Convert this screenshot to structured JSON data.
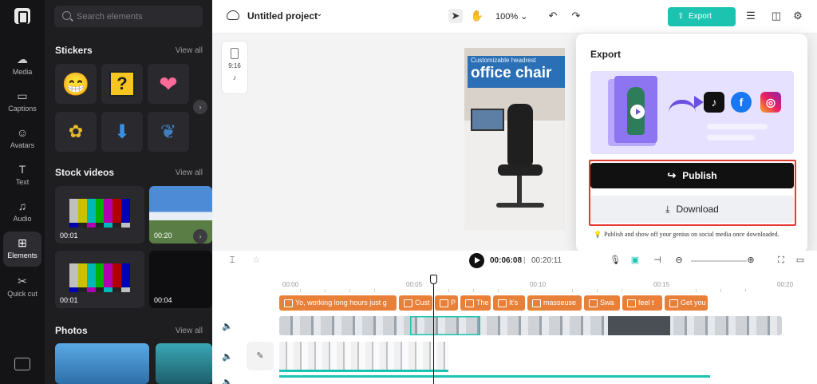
{
  "sidebar": {
    "items": [
      {
        "label": "Media",
        "icon": "media-icon"
      },
      {
        "label": "Captions",
        "icon": "captions-icon"
      },
      {
        "label": "Avatars",
        "icon": "avatars-icon"
      },
      {
        "label": "Text",
        "icon": "text-icon"
      },
      {
        "label": "Audio",
        "icon": "audio-icon"
      },
      {
        "label": "Elements",
        "icon": "elements-icon",
        "active": true
      },
      {
        "label": "Quick cut",
        "icon": "quick-cut-icon"
      }
    ]
  },
  "panel": {
    "search_placeholder": "Search elements",
    "sections": {
      "stickers": {
        "title": "Stickers",
        "view_all": "View all"
      },
      "stock_videos": {
        "title": "Stock videos",
        "view_all": "View all"
      },
      "photos": {
        "title": "Photos",
        "view_all": "View all"
      }
    },
    "videos": [
      {
        "duration": "00:01"
      },
      {
        "duration": "00:20"
      },
      {
        "duration": "00:01"
      },
      {
        "duration": "00:04"
      }
    ]
  },
  "topbar": {
    "project_title": "Untitled project",
    "zoom": "100%",
    "export_label": "Export"
  },
  "canvas": {
    "ratio_label": "9:16",
    "preview_small": "Customizable headrest",
    "preview_big": "office chair"
  },
  "export_popup": {
    "title": "Export",
    "publish_label": "Publish",
    "download_label": "Download",
    "tip": "Publish and show off your genius on social media once downloaded."
  },
  "timeline": {
    "current_time": "00:06:08",
    "separator": "|",
    "total_time": "00:20:11",
    "ruler": [
      "00:00",
      "00:05",
      "00:10",
      "00:15",
      "00:20"
    ],
    "captions": [
      "Yo, working long hours just g",
      "Cust",
      "P",
      "The",
      "It's",
      "masseuse",
      "Swa",
      "feel t",
      "Get you"
    ]
  },
  "colors": {
    "accent": "#1bc3b0",
    "caption_clip": "#e8803a",
    "highlight": "#e53935"
  }
}
